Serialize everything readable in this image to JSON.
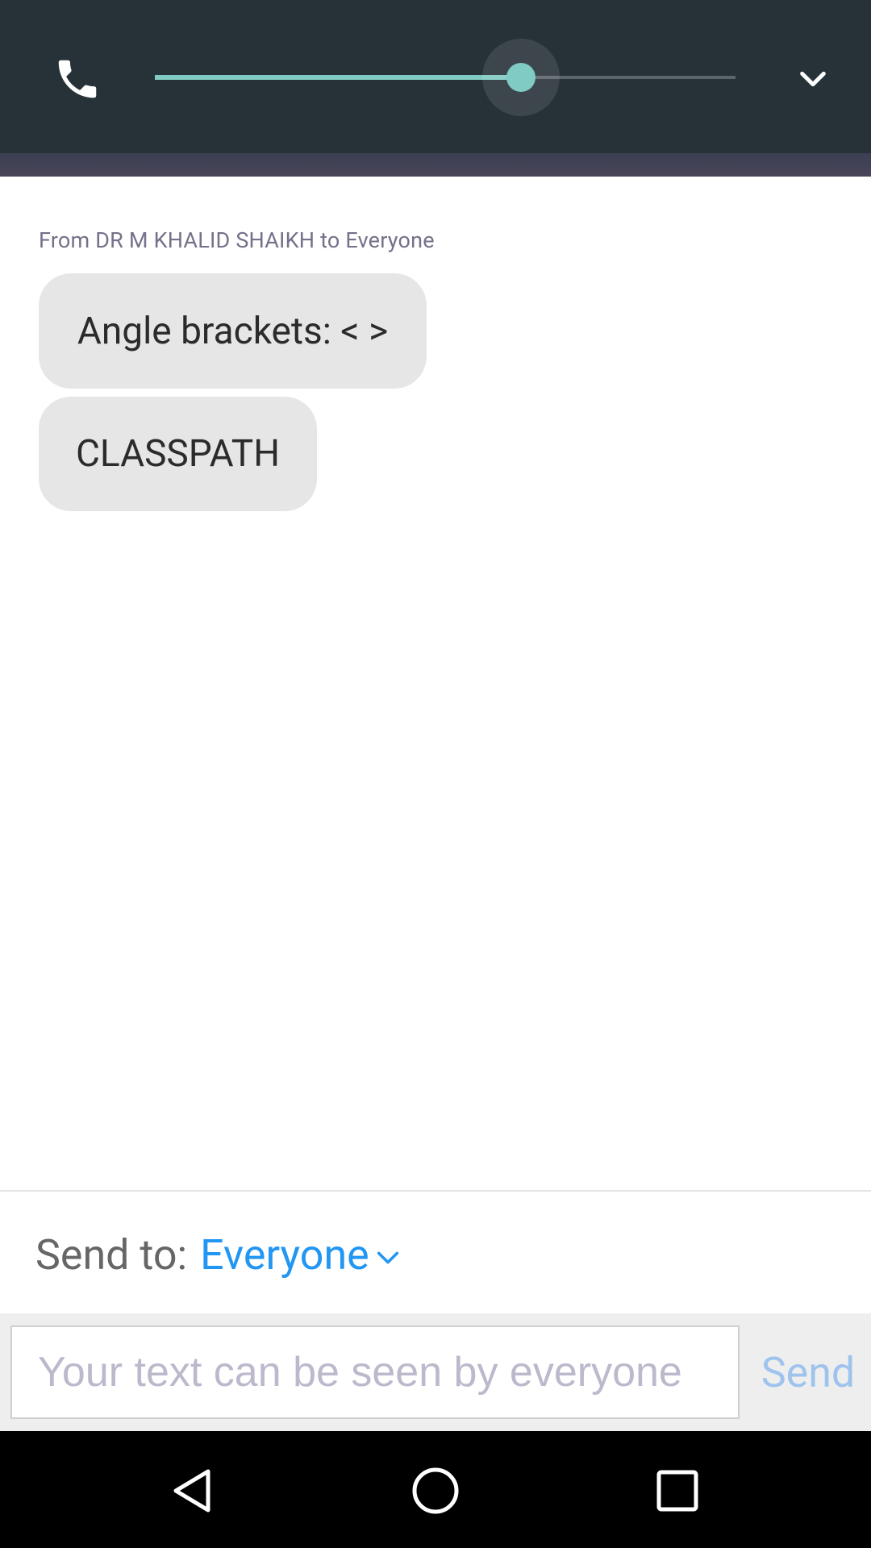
{
  "call_bar": {
    "volume_level_percent": 63,
    "colors": {
      "background": "#263238",
      "accent": "#80cbc4"
    },
    "icons": {
      "call": "phone-icon",
      "collapse": "chevron-down-icon"
    }
  },
  "chat": {
    "from_line": "From DR M KHALID SHAIKH to Everyone",
    "messages": [
      {
        "text": "Angle brackets: < >"
      },
      {
        "text": "CLASSPATH"
      }
    ]
  },
  "composer": {
    "send_to_label": "Send to:",
    "send_to_value": "Everyone",
    "input_placeholder": "Your text can be seen by everyone",
    "input_value": "",
    "send_label": "Send",
    "colors": {
      "link": "#2196f3",
      "send_disabled": "#9ec4ee"
    }
  },
  "navigation": {
    "icons": [
      "back-icon",
      "home-icon",
      "recents-icon"
    ]
  }
}
